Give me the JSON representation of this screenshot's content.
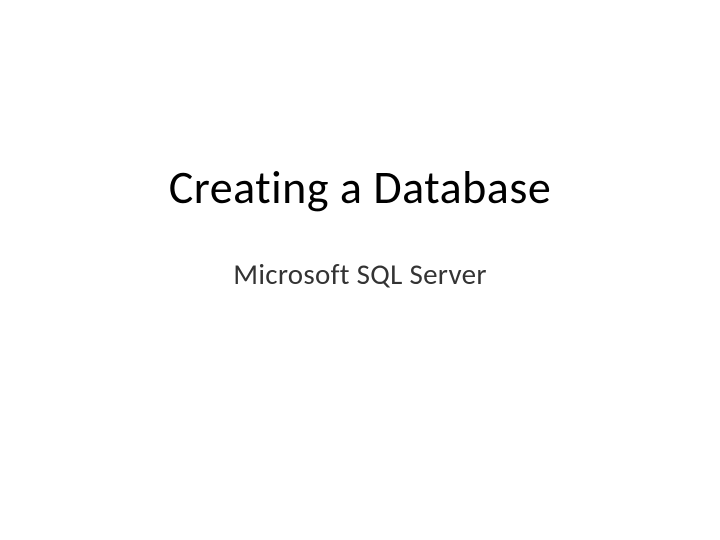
{
  "slide": {
    "title": "Creating a Database",
    "subtitle": "Microsoft SQL Server"
  }
}
